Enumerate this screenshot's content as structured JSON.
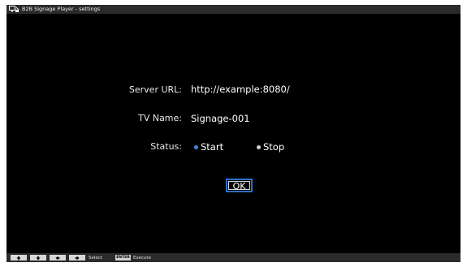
{
  "window": {
    "title": "B2B Signage Player - settings",
    "icon": "display-player-icon"
  },
  "form": {
    "server_url_label": "Server URL:",
    "server_url_value": "http://example:8080/",
    "tv_name_label": "TV Name:",
    "tv_name_value": "Signage-001",
    "status_label": "Status:",
    "status_options": [
      {
        "label": "Start",
        "selected": true
      },
      {
        "label": "Stop",
        "selected": false
      }
    ],
    "ok_label": "OK"
  },
  "footer": {
    "keys": [
      "up-arrow-icon",
      "down-arrow-icon",
      "left-arrow-icon",
      "right-arrow-icon"
    ],
    "select_label": "Select",
    "enter_key": "ENTER",
    "execute_label": "Execute"
  },
  "colors": {
    "selected_dot": "#3d8be0",
    "unselected_dot": "#d0d0d0",
    "focus_border": "#2c6fc9"
  }
}
